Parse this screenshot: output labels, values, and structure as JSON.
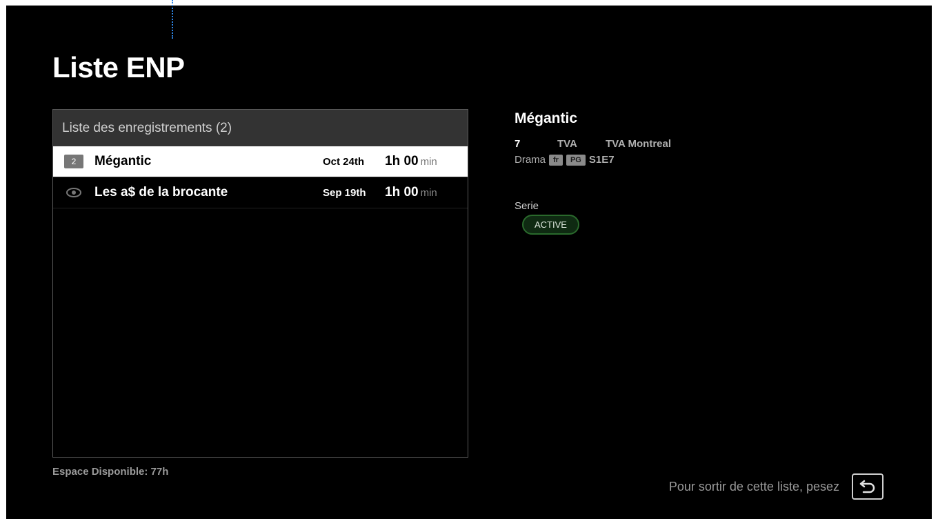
{
  "page": {
    "title": "Liste ENP"
  },
  "recordings": {
    "header": "Liste des enregistrements (2)",
    "items": [
      {
        "badge": "2",
        "icon": "",
        "title": "Mégantic",
        "date": "Oct 24th",
        "duration": "1h 00",
        "unit": "min",
        "selected": true
      },
      {
        "badge": "",
        "icon": "eye-icon",
        "title": "Les a$ de la brocante",
        "date": "Sep 19th",
        "duration": "1h 00",
        "unit": "min",
        "selected": false
      }
    ]
  },
  "storage": {
    "label": "Espace Disponible: 77h"
  },
  "detail": {
    "title": "Mégantic",
    "channel_number": "7",
    "channel_call": "TVA",
    "channel_name": "TVA Montreal",
    "genre": "Drama",
    "language": "fr",
    "rating": "PG",
    "episode": "S1E7",
    "series_label": "Serie",
    "series_status": "ACTIVE"
  },
  "footer": {
    "exit_hint": "Pour sortir de cette liste, pesez",
    "back_icon": "back-arrow-icon"
  },
  "colors": {
    "background": "#000000",
    "selected_row": "#ffffff",
    "status_border": "#2a6a2c",
    "status_fill": "#0f2a12"
  }
}
